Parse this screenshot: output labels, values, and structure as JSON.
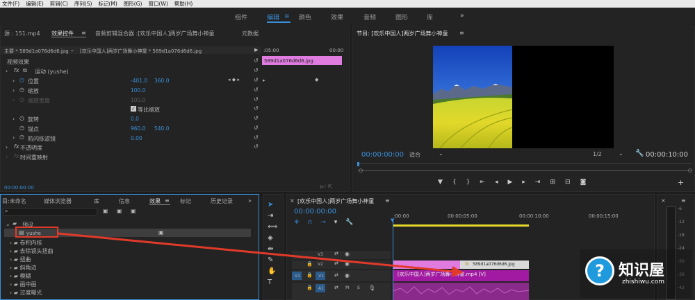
{
  "menu": [
    "文件(F)",
    "编辑(E)",
    "剪辑(C)",
    "序列(S)",
    "标记(M)",
    "图形(G)",
    "窗口(W)",
    "帮助(H)"
  ],
  "workspaces": [
    "组件",
    "编辑",
    "颜色",
    "效果",
    "音频",
    "图形",
    "库",
    "»"
  ],
  "source_panel": {
    "tabs": [
      "源 : 151.mp4",
      "效果控件",
      "音频剪辑混合器 :[欢乐中国人]两岁广场舞小神童",
      "元数据"
    ],
    "master": "主要 * 589d1a076d6d6.jpg",
    "clip": "[欢乐中国人]两岁广场舞小神童 * 589d1a076d6d6.jpg",
    "video_effects": "视频效果",
    "motion": "运动 (yushe)",
    "props": [
      {
        "name": "位置",
        "v1": "-401.0",
        "v2": "360.0"
      },
      {
        "name": "缩放",
        "v1": "100.0",
        "v2": ""
      },
      {
        "name": "缩放宽度",
        "v1": "100.0",
        "v2": ""
      },
      {
        "name": "等比缩放",
        "v1": "",
        "v2": ""
      },
      {
        "name": "旋转",
        "v1": "0.0",
        "v2": ""
      },
      {
        "name": "锚点",
        "v1": "960.0",
        "v2": "540.0"
      },
      {
        "name": "防闪烁滤镜",
        "v1": "0.00",
        "v2": ""
      }
    ],
    "opacity": "不透明度",
    "time_remap": "时间重映射",
    "timecode": "00:00:00:00",
    "tl_start": ":05:00",
    "tl_end": "00:00",
    "clip_label": "589d1a076d6d6.jpg"
  },
  "program": {
    "title": "节目: [欢乐中国人]两岁广场舞小神童",
    "timecode": "00:00:00:00",
    "fit": "适合",
    "ratio": "1/2",
    "duration": "00:00:10:00"
  },
  "project": {
    "tabs": [
      "目:未命名",
      "媒体浏览器",
      "库",
      "信息",
      "效果",
      "标记",
      "历史记录"
    ],
    "search_placeholder": "",
    "items": [
      "预设",
      "yushe",
      "卷积内核",
      "去除镜头扭曲",
      "扭曲",
      "斜角边",
      "模糊",
      "画中画",
      "过度曝光"
    ]
  },
  "timeline": {
    "title": "[欢乐中国人]两岁广场舞小神童",
    "timecode": "00:00:00:00",
    "ruler": [
      ":00:00",
      "00:00:05:00",
      "00:00:10:00",
      "00:00:15:00"
    ],
    "tracks": [
      "V3",
      "V2",
      "V1",
      "A1"
    ],
    "clip_v2": "589d1a076d6d6.jpg",
    "clip_v1": "[欢乐中国人]两岁广场舞小神童.mp4 [V]"
  },
  "watermark": {
    "name": "知识屋",
    "url": "zhishiwu.com"
  },
  "meter": [
    "-6",
    "-12",
    "-18",
    "-24",
    "-30",
    "-36",
    "-42"
  ]
}
